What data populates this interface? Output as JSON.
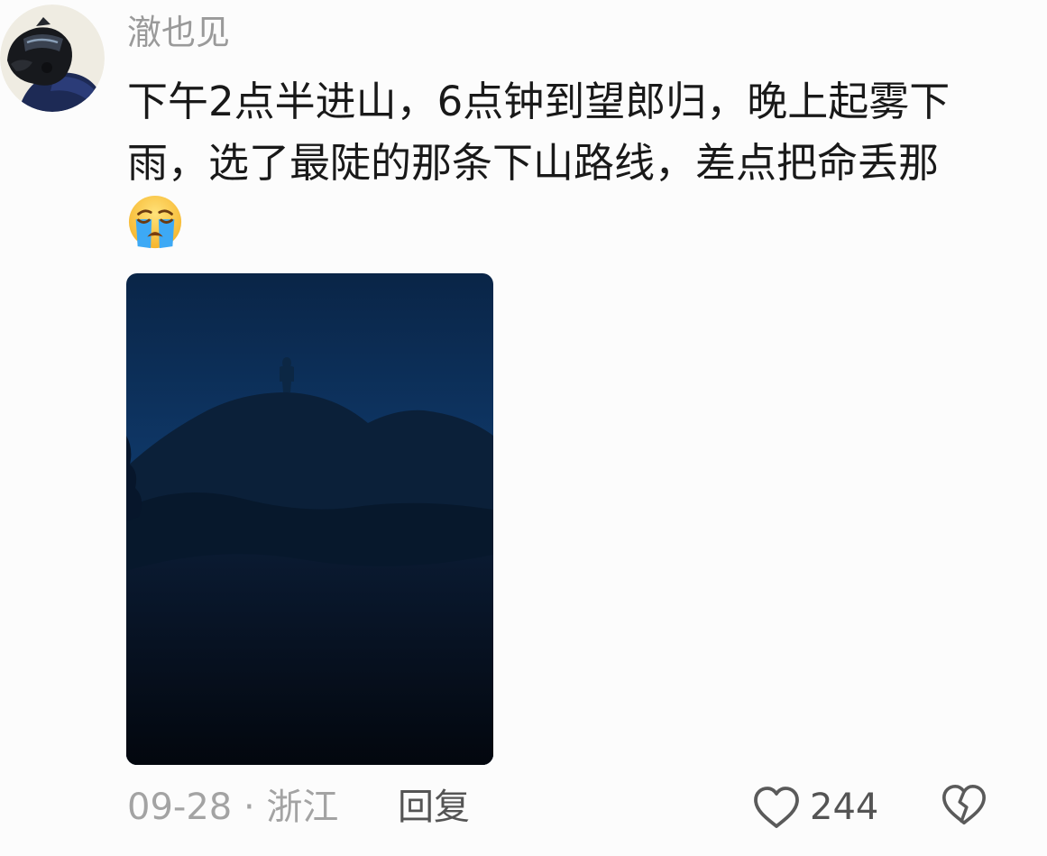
{
  "comment": {
    "username": "澈也见",
    "text": "下午2点半进山，6点钟到望郎归，晚上起雾下雨，选了最陡的那条下山路线，差点把命丢那",
    "emoji": "loudly-crying-face",
    "date": "09-28",
    "separator": "·",
    "location": "浙江",
    "reply_label": "回复",
    "like_count": "244",
    "avatar_icon": "helmet-avatar",
    "like_icon": "heart-outline-icon",
    "dislike_icon": "broken-heart-icon"
  },
  "colors": {
    "background": "#fcfcfc",
    "username": "#9a9a9a",
    "text": "#191919",
    "meta": "#a3a3a3",
    "action": "#545454"
  }
}
